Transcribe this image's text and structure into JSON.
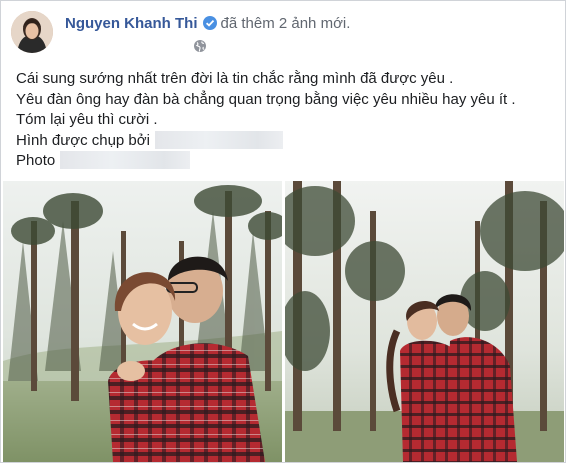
{
  "post": {
    "author": "Nguyen Khanh Thi",
    "action": "đã thêm 2 ảnh mới.",
    "privacy_icon": "globe-icon",
    "verified_icon": "verified-badge-icon",
    "lines": [
      "Cái sung sướng nhất trên đời là tin chắc rằng mình đã được yêu .",
      "Yêu đàn ông hay đàn bà chẳng quan trọng bằng việc yêu nhiều hay yêu ít .",
      "Tóm lại yêu thì cười .",
      "Hình được chụp bởi",
      "Photo"
    ]
  },
  "photos": [
    {
      "name": "couple-forest-photo-1"
    },
    {
      "name": "couple-forest-photo-2"
    }
  ],
  "colors": {
    "author": "#365899",
    "verified": "#4a90e2",
    "shirt": "#b52a31"
  }
}
